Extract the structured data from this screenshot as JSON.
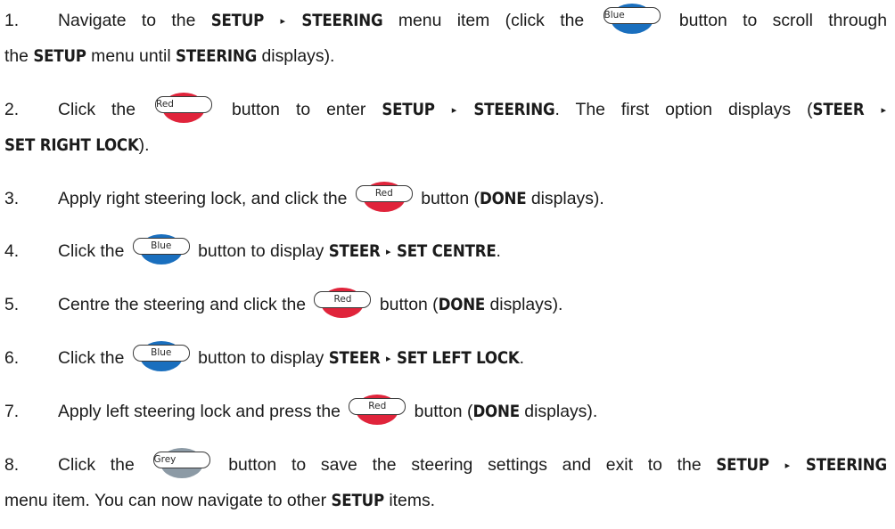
{
  "buttons": {
    "blue": "Blue",
    "red": "Red",
    "grey": "Grey"
  },
  "steps": [
    {
      "num": "1.",
      "l1_a": "Navigate to the ",
      "l1_b": "SETUP",
      "l1_c": "STEERING",
      "l1_d": " menu item (click the ",
      "l1_e": " button to scroll through",
      "l2_a": "the ",
      "l2_b": "SETUP",
      "l2_c": " menu until ",
      "l2_d": "STEERING",
      "l2_e": " displays)."
    },
    {
      "num": "2.",
      "l1_a": "Click the ",
      "l1_b": " button to enter ",
      "l1_c": "SETUP",
      "l1_d": "STEERING",
      "l1_e": ". The first option displays (",
      "l1_f": "STEER",
      "l2_a": "SET RIGHT LOCK",
      "l2_b": ")."
    },
    {
      "num": "3.",
      "a": "Apply right steering lock, and click the ",
      "b": " button (",
      "c": "DONE",
      "d": " displays)."
    },
    {
      "num": "4.",
      "a": "Click the ",
      "b": " button to display ",
      "c": "STEER",
      "d": "SET CENTRE",
      "e": "."
    },
    {
      "num": "5.",
      "a": "Centre the steering and click the ",
      "b": " button (",
      "c": "DONE",
      "d": " displays)."
    },
    {
      "num": "6.",
      "a": "Click the ",
      "b": " button to display ",
      "c": "STEER",
      "d": "SET LEFT LOCK",
      "e": "."
    },
    {
      "num": "7.",
      "a": "Apply left steering lock and press the ",
      "b": " button (",
      "c": "DONE",
      "d": " displays)."
    },
    {
      "num": "8.",
      "l1_a": "Click the ",
      "l1_b": " button to save the steering settings and exit to the ",
      "l1_c": "SETUP",
      "l1_d": "STEERING",
      "l2_a": "menu item. You can now navigate to other ",
      "l2_b": "SETUP",
      "l2_c": " items."
    }
  ],
  "arrow_glyph": "▸"
}
